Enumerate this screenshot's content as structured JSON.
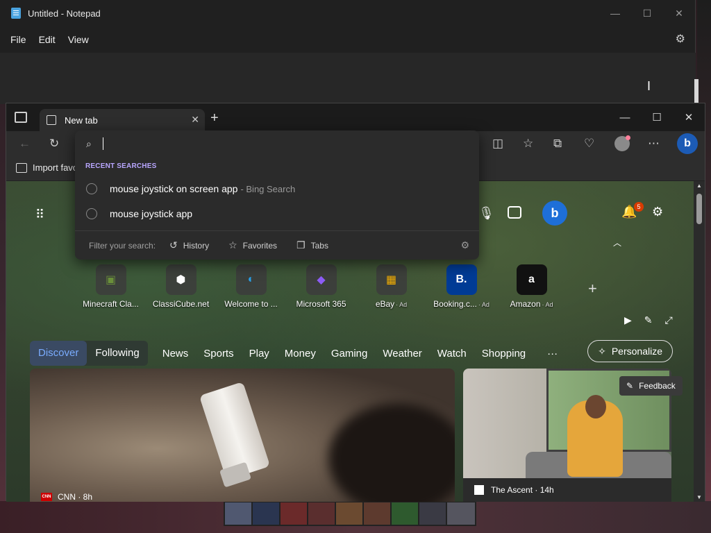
{
  "notepad": {
    "title": "Untitled - Notepad",
    "menu": [
      "File",
      "Edit",
      "View"
    ],
    "window_buttons": {
      "minimize": "—",
      "maximize": "☐",
      "close": "✕"
    },
    "settings_icon": "gear-icon"
  },
  "edge": {
    "tab": {
      "label": "New tab",
      "close": "✕"
    },
    "new_tab": "+",
    "window_buttons": {
      "minimize": "—",
      "maximize": "☐",
      "close": "✕"
    },
    "toolbar": {
      "back": "←",
      "refresh": "↻",
      "split": "◫",
      "favorites": "☆",
      "collections": "⧉",
      "performance": "♡",
      "more": "⋯",
      "copilot": "b"
    },
    "favorites_bar": {
      "import_label": "Import favo"
    },
    "omnibox": {
      "recent_header": "RECENT SEARCHES",
      "suggestions": [
        {
          "text": "mouse joystick on screen app",
          "sub": "- Bing Search"
        },
        {
          "text": "mouse joystick app",
          "sub": ""
        }
      ],
      "filter_label": "Filter your search:",
      "filters": [
        {
          "label": "History",
          "icon": "history-icon"
        },
        {
          "label": "Favorites",
          "icon": "star-icon"
        },
        {
          "label": "Tabs",
          "icon": "tabs-icon"
        }
      ]
    }
  },
  "ntp": {
    "notification_count": "5",
    "quick_links": [
      {
        "label": "Minecraft Cla...",
        "ad": "",
        "glyph": "▣",
        "color": "#6a8f3a"
      },
      {
        "label": "ClassiCube.net",
        "ad": "",
        "glyph": "⬢",
        "color": "#ffffff"
      },
      {
        "label": "Welcome to ...",
        "ad": "",
        "glyph": "◐",
        "color": "#2aa0e8"
      },
      {
        "label": "Microsoft 365",
        "ad": "",
        "glyph": "◆",
        "color": "#8d5cf6"
      },
      {
        "label": "eBay",
        "ad": "· Ad",
        "glyph": "▦",
        "color": "#f5af02"
      },
      {
        "label": "Booking.c...",
        "ad": "· Ad",
        "glyph": "B.",
        "color": "#ffffff"
      },
      {
        "label": "Amazon",
        "ad": "· Ad",
        "glyph": "a",
        "color": "#ffffff"
      }
    ],
    "feed": {
      "segments": [
        "Discover",
        "Following"
      ],
      "tabs": [
        "News",
        "Sports",
        "Play",
        "Money",
        "Gaming",
        "Weather",
        "Watch",
        "Shopping"
      ],
      "more": "···",
      "personalize": "Personalize"
    },
    "cards": [
      {
        "source": "CNN · 8h",
        "logo": "CNN"
      },
      {
        "source": "The Ascent · 14h"
      }
    ],
    "feedback": "Feedback"
  }
}
